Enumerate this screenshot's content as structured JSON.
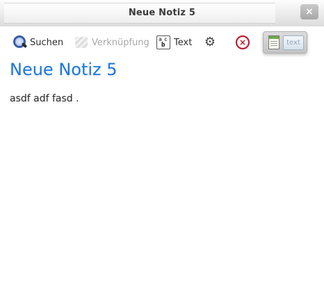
{
  "window": {
    "title": "Neue Notiz 5",
    "close_label": "×"
  },
  "toolbar": {
    "search_label": "Suchen",
    "link_label": "Verknüpfung",
    "text_label": "Text",
    "text_icon_glyphs": {
      "a": "a",
      "c": "c",
      "b": "b"
    },
    "gear_glyph": "⚙",
    "stop_glyph": "×",
    "mode_text_label": "text"
  },
  "note": {
    "title": "Neue Notiz 5",
    "body": "asdf adf fasd ."
  },
  "colors": {
    "title_blue": "#1c78e0",
    "stop_red": "#c0142b"
  }
}
